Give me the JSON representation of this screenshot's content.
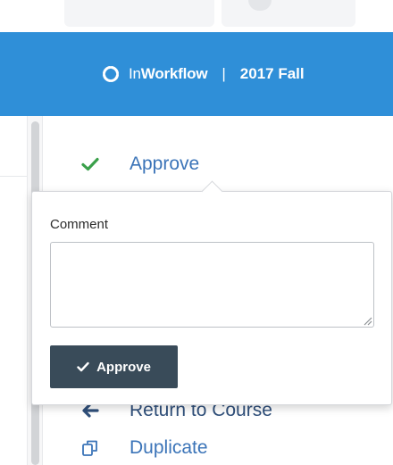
{
  "header": {
    "app_name_prefix": "In",
    "app_name_bold": "Workflow",
    "separator": "|",
    "term": "2017 Fall",
    "background": "#2f8fd8",
    "logo_icon": "circular-arrows-icon"
  },
  "menu": {
    "approve_label": "Approve",
    "approve_icon": "checkmark-icon",
    "return_label": "Return to Course",
    "return_icon": "arrow-left-icon",
    "duplicate_label": "Duplicate",
    "duplicate_icon": "copy-icon",
    "link_color": "#3b74b8",
    "check_color": "#3aa04a"
  },
  "approve_popover": {
    "comment_label": "Comment",
    "comment_value": "",
    "submit_label": "Approve",
    "submit_icon": "checkmark-icon",
    "submit_bg": "#394b59"
  }
}
